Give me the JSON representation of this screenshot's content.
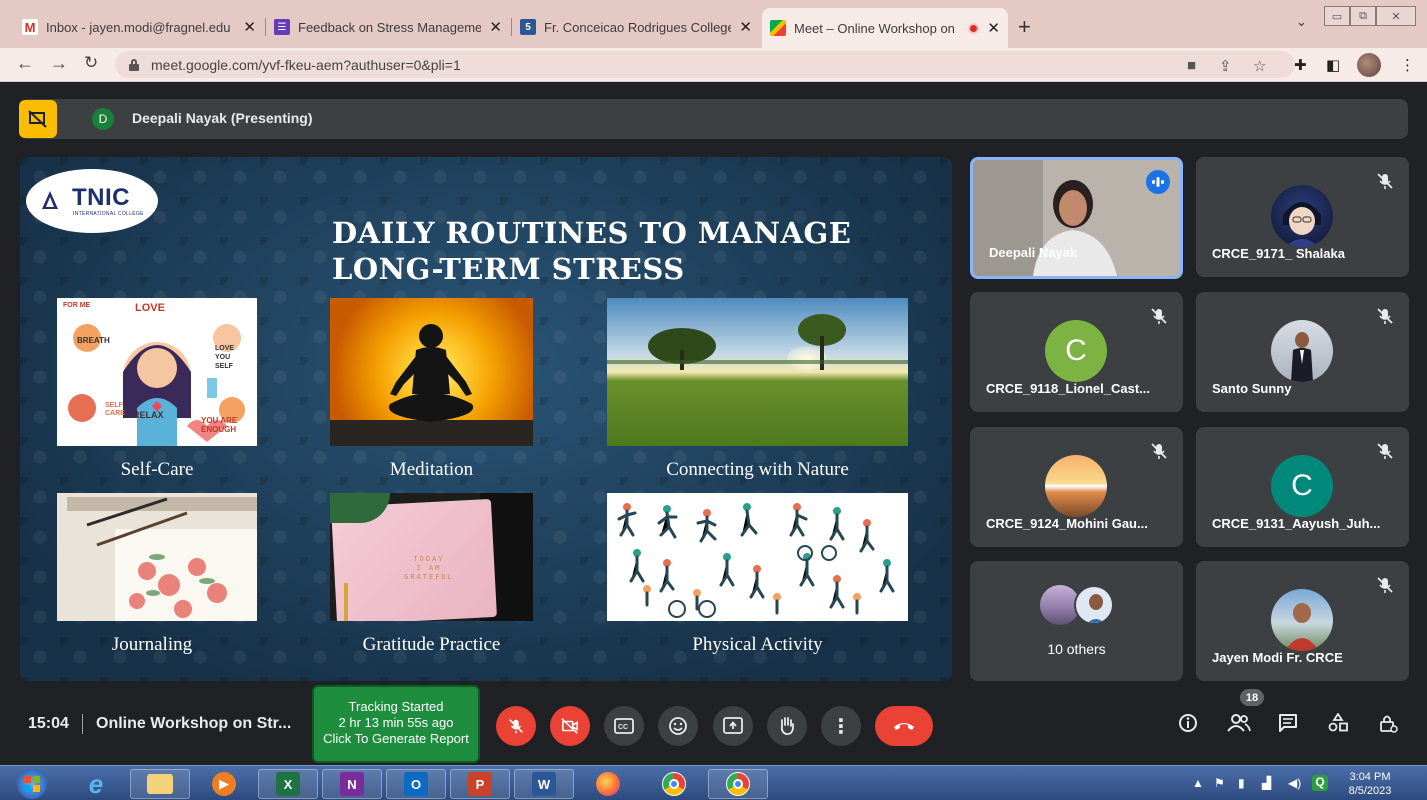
{
  "browser": {
    "tabs": [
      {
        "title": "Inbox - jayen.modi@fragnel.edu",
        "icon": "gmail-icon"
      },
      {
        "title": "Feedback on Stress Management",
        "icon": "forms-icon"
      },
      {
        "title": "Fr. Conceicao Rodrigues College",
        "icon": "college-icon"
      },
      {
        "title": "Meet – Online Workshop on",
        "icon": "meet-icon"
      }
    ],
    "new_tab": "+",
    "url": "meet.google.com/yvf-fkeu-aem?authuser=0&pli=1"
  },
  "meet": {
    "presenter_initial": "D",
    "presenter_label": "Deepali Nayak (Presenting)",
    "slide": {
      "logo_text": "TNIC",
      "logo_sub": "INTERNATIONAL COLLEGE",
      "title_line1": "DAILY ROUTINES TO MANAGE",
      "title_line2": "LONG-TERM STRESS",
      "items": [
        "Self-Care",
        "Meditation",
        "Connecting with Nature",
        "Journaling",
        "Gratitude Practice",
        "Physical Activity"
      ],
      "self_care_words": [
        "LOVE",
        "BREATH",
        "LOVE YOU SELF",
        "RELAX",
        "SELF CARE",
        "YOU ARE ENOUGH",
        "FOR ME"
      ],
      "journal_words": [
        "TODAY",
        "I AM",
        "GRATEFUL"
      ]
    },
    "participants": [
      {
        "name": "Deepali Nayak",
        "speaking": true,
        "initial": ""
      },
      {
        "name": "CRCE_9171_ Shalaka",
        "muted": true,
        "initial": ""
      },
      {
        "name": "CRCE_9118_Lionel_Cast...",
        "muted": true,
        "initial": "C",
        "color": "#7cb342"
      },
      {
        "name": "Santo Sunny",
        "muted": true,
        "initial": ""
      },
      {
        "name": "CRCE_9124_Mohini Gau...",
        "muted": true,
        "initial": ""
      },
      {
        "name": "CRCE_9131_Aayush_Juh...",
        "muted": true,
        "initial": "C",
        "color": "#00897b"
      },
      {
        "name": "10 others",
        "initial": ""
      },
      {
        "name": "Jayen Modi Fr. CRCE",
        "muted": true,
        "initial": ""
      }
    ],
    "time": "15:04",
    "meeting_title": "Online Workshop on Str...",
    "tracking": {
      "line1": "Tracking Started",
      "line2": "2 hr 13 min 55s ago",
      "line3": "Click To Generate Report"
    },
    "people_count": "18"
  },
  "taskbar": {
    "apps": [
      {
        "icon": "windows-start-icon"
      },
      {
        "icon": "internet-explorer-icon"
      },
      {
        "icon": "file-explorer-icon"
      },
      {
        "icon": "media-player-icon"
      },
      {
        "icon": "excel-icon",
        "label": "X"
      },
      {
        "icon": "onenote-icon",
        "label": "N"
      },
      {
        "icon": "outlook-icon",
        "label": "O"
      },
      {
        "icon": "powerpoint-icon",
        "label": "P"
      },
      {
        "icon": "word-icon",
        "label": "W"
      },
      {
        "icon": "firefox-icon"
      },
      {
        "icon": "chrome-icon"
      },
      {
        "icon": "chrome-icon"
      }
    ],
    "clock_time": "3:04 PM",
    "clock_date": "8/5/2023"
  }
}
